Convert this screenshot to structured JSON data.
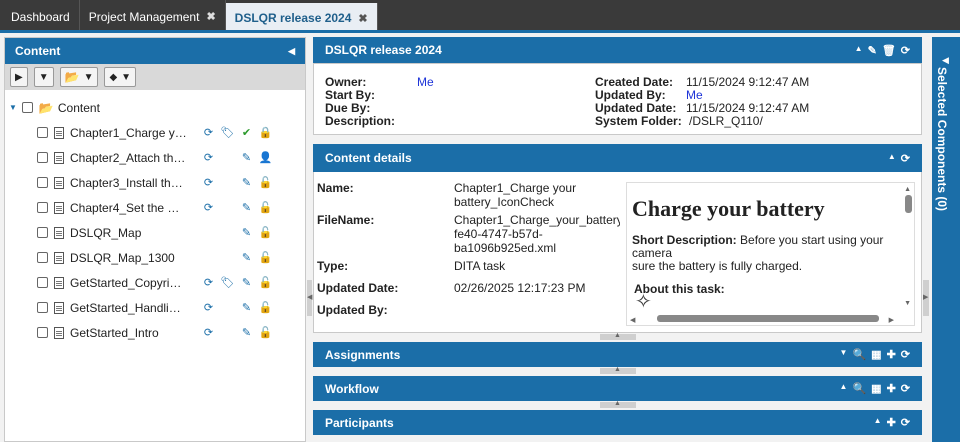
{
  "tabs": [
    {
      "label": "Dashboard",
      "closable": false
    },
    {
      "label": "Project Management",
      "closable": true
    },
    {
      "label": "DSLQR release 2024",
      "closable": true
    }
  ],
  "content_panel": {
    "title": "Content",
    "tree_root": "Content",
    "items": [
      {
        "label": "Chapter1_Charge you...",
        "icons": [
          "refresh-icon",
          "tag-icon",
          "checkmark-icon",
          "lock-icon"
        ]
      },
      {
        "label": "Chapter2_Attach the s...",
        "icons": [
          "refresh-icon",
          "",
          "edit-icon",
          "user-icon"
        ]
      },
      {
        "label": "Chapter3_Install the b...",
        "icons": [
          "refresh-icon",
          "",
          "edit-icon",
          "unlock-icon"
        ]
      },
      {
        "label": "Chapter4_Set the Dat...",
        "icons": [
          "refresh-icon",
          "",
          "edit-icon",
          "unlock-icon"
        ]
      },
      {
        "label": "DSLQR_Map",
        "icons": [
          "",
          "",
          "edit-icon",
          "unlock-icon"
        ]
      },
      {
        "label": "DSLQR_Map_1300",
        "icons": [
          "",
          "",
          "edit-icon",
          "unlock-icon"
        ]
      },
      {
        "label": "GetStarted_Copyrights",
        "icons": [
          "refresh-icon",
          "tag-icon",
          "edit-icon",
          "unlock-icon"
        ]
      },
      {
        "label": "GetStarted_Handling ...",
        "icons": [
          "refresh-icon",
          "",
          "edit-icon",
          "unlock-icon"
        ]
      },
      {
        "label": "GetStarted_Intro",
        "icons": [
          "refresh-icon",
          "",
          "edit-icon",
          "unlock-icon"
        ]
      }
    ]
  },
  "release": {
    "title": "DSLQR release 2024",
    "owner_label": "Owner:",
    "owner": "Me",
    "start_by_label": "Start By:",
    "due_by_label": "Due By:",
    "description_label": "Description:",
    "created_date_label": "Created Date:",
    "created_date": "11/15/2024 9:12:47 AM",
    "updated_by_label": "Updated By:",
    "updated_by": "Me",
    "updated_date_label": "Updated Date:",
    "updated_date": "11/15/2024 9:12:47 AM",
    "system_folder_label": "System Folder:",
    "system_folder": "/DSLR_Q110/"
  },
  "content_details": {
    "title": "Content details",
    "name_label": "Name:",
    "name_line1": "Chapter1_Charge your",
    "name_line2": "battery_IconCheck",
    "filename_label": "FileName:",
    "filename_line1": "Chapter1_Charge_your_battery_Ic",
    "filename_line2": "fe40-4747-b57d-",
    "filename_line3": "ba1096b925ed.xml",
    "type_label": "Type:",
    "type": "DITA task",
    "updated_date_label": "Updated Date:",
    "updated_date": "02/26/2025 12:17:23 PM",
    "updated_by_label": "Updated By:",
    "preview": {
      "heading": "Charge your battery",
      "short_desc_label": "Short Description:",
      "short_desc_line1": "Before you start using your camera",
      "short_desc_line2": "sure the battery is fully charged.",
      "about": "About this task:"
    }
  },
  "sections": {
    "assignments": "Assignments",
    "workflow": "Workflow",
    "participants": "Participants"
  },
  "right_strip": {
    "label": "Selected Components (0)"
  },
  "colors": {
    "accent": "#1b6ea8",
    "tabbar": "#3a3a3a",
    "link": "#1d33d8",
    "green": "#2c9a2c"
  }
}
